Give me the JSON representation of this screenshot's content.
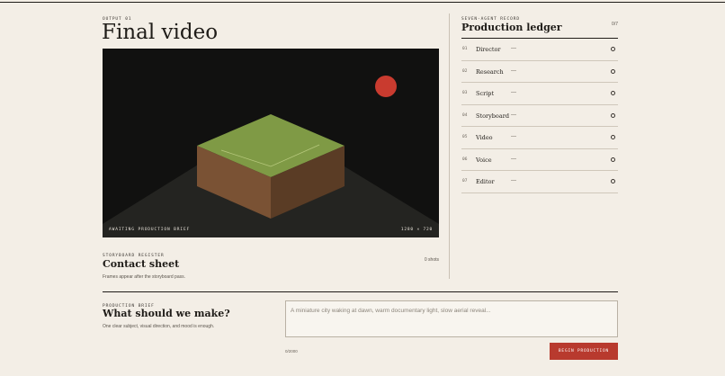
{
  "output": {
    "eyebrow": "OUTPUT 01",
    "title": "Final video"
  },
  "video": {
    "status": "AWAITING PRODUCTION BRIEF",
    "resolution": "1280 × 720"
  },
  "storyboard": {
    "eyebrow": "STORYBOARD REGISTER",
    "title": "Contact sheet",
    "shots": "0 shots",
    "note": "Frames appear after the storyboard pass."
  },
  "ledger": {
    "eyebrow": "SEVEN-AGENT RECORD",
    "title": "Production ledger",
    "count": "0/7",
    "rows": [
      {
        "num": "01",
        "name": "Director",
        "state": "—"
      },
      {
        "num": "02",
        "name": "Research",
        "state": "—"
      },
      {
        "num": "03",
        "name": "Script",
        "state": "—"
      },
      {
        "num": "04",
        "name": "Storyboard",
        "state": "—"
      },
      {
        "num": "05",
        "name": "Video",
        "state": "—"
      },
      {
        "num": "06",
        "name": "Voice",
        "state": "—"
      },
      {
        "num": "07",
        "name": "Editor",
        "state": "—"
      }
    ]
  },
  "brief": {
    "eyebrow": "PRODUCTION BRIEF",
    "title": "What should we make?",
    "note": "One clear subject, visual direction, and mood is enough.",
    "placeholder": "A miniature city waking at dawn, warm documentary light, slow aerial reveal...",
    "value": "",
    "char_count": "0/2000",
    "button_label": "BEGIN PRODUCTION"
  },
  "colors": {
    "background": "#f3eee6",
    "accent": "#b83a2e",
    "video_bg": "#111110",
    "cube_top": "#7f9a45",
    "cube_left": "#7a5234",
    "cube_right": "#5a3c25",
    "sun": "#c93b2f"
  }
}
